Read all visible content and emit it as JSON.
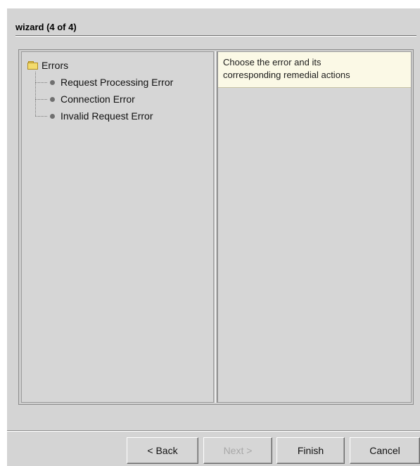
{
  "dialog": {
    "title": "wizard (4 of 4)"
  },
  "tree": {
    "root_label": "Errors",
    "root_icon": "folder-icon",
    "items": [
      {
        "label": "Request Processing Error"
      },
      {
        "label": "Connection Error"
      },
      {
        "label": "Invalid Request Error"
      }
    ]
  },
  "description": {
    "text": "Choose the error and its corresponding remedial actions",
    "line1": "Choose the error and its",
    "line2": "corresponding remedial actions"
  },
  "buttons": {
    "back": "< Back",
    "next": "Next >",
    "finish": "Finish",
    "cancel": "Cancel"
  },
  "colors": {
    "dialog_bg": "#d4d4d4",
    "description_bg": "#fbf9e6",
    "disabled_text": "#a8a8a8"
  }
}
